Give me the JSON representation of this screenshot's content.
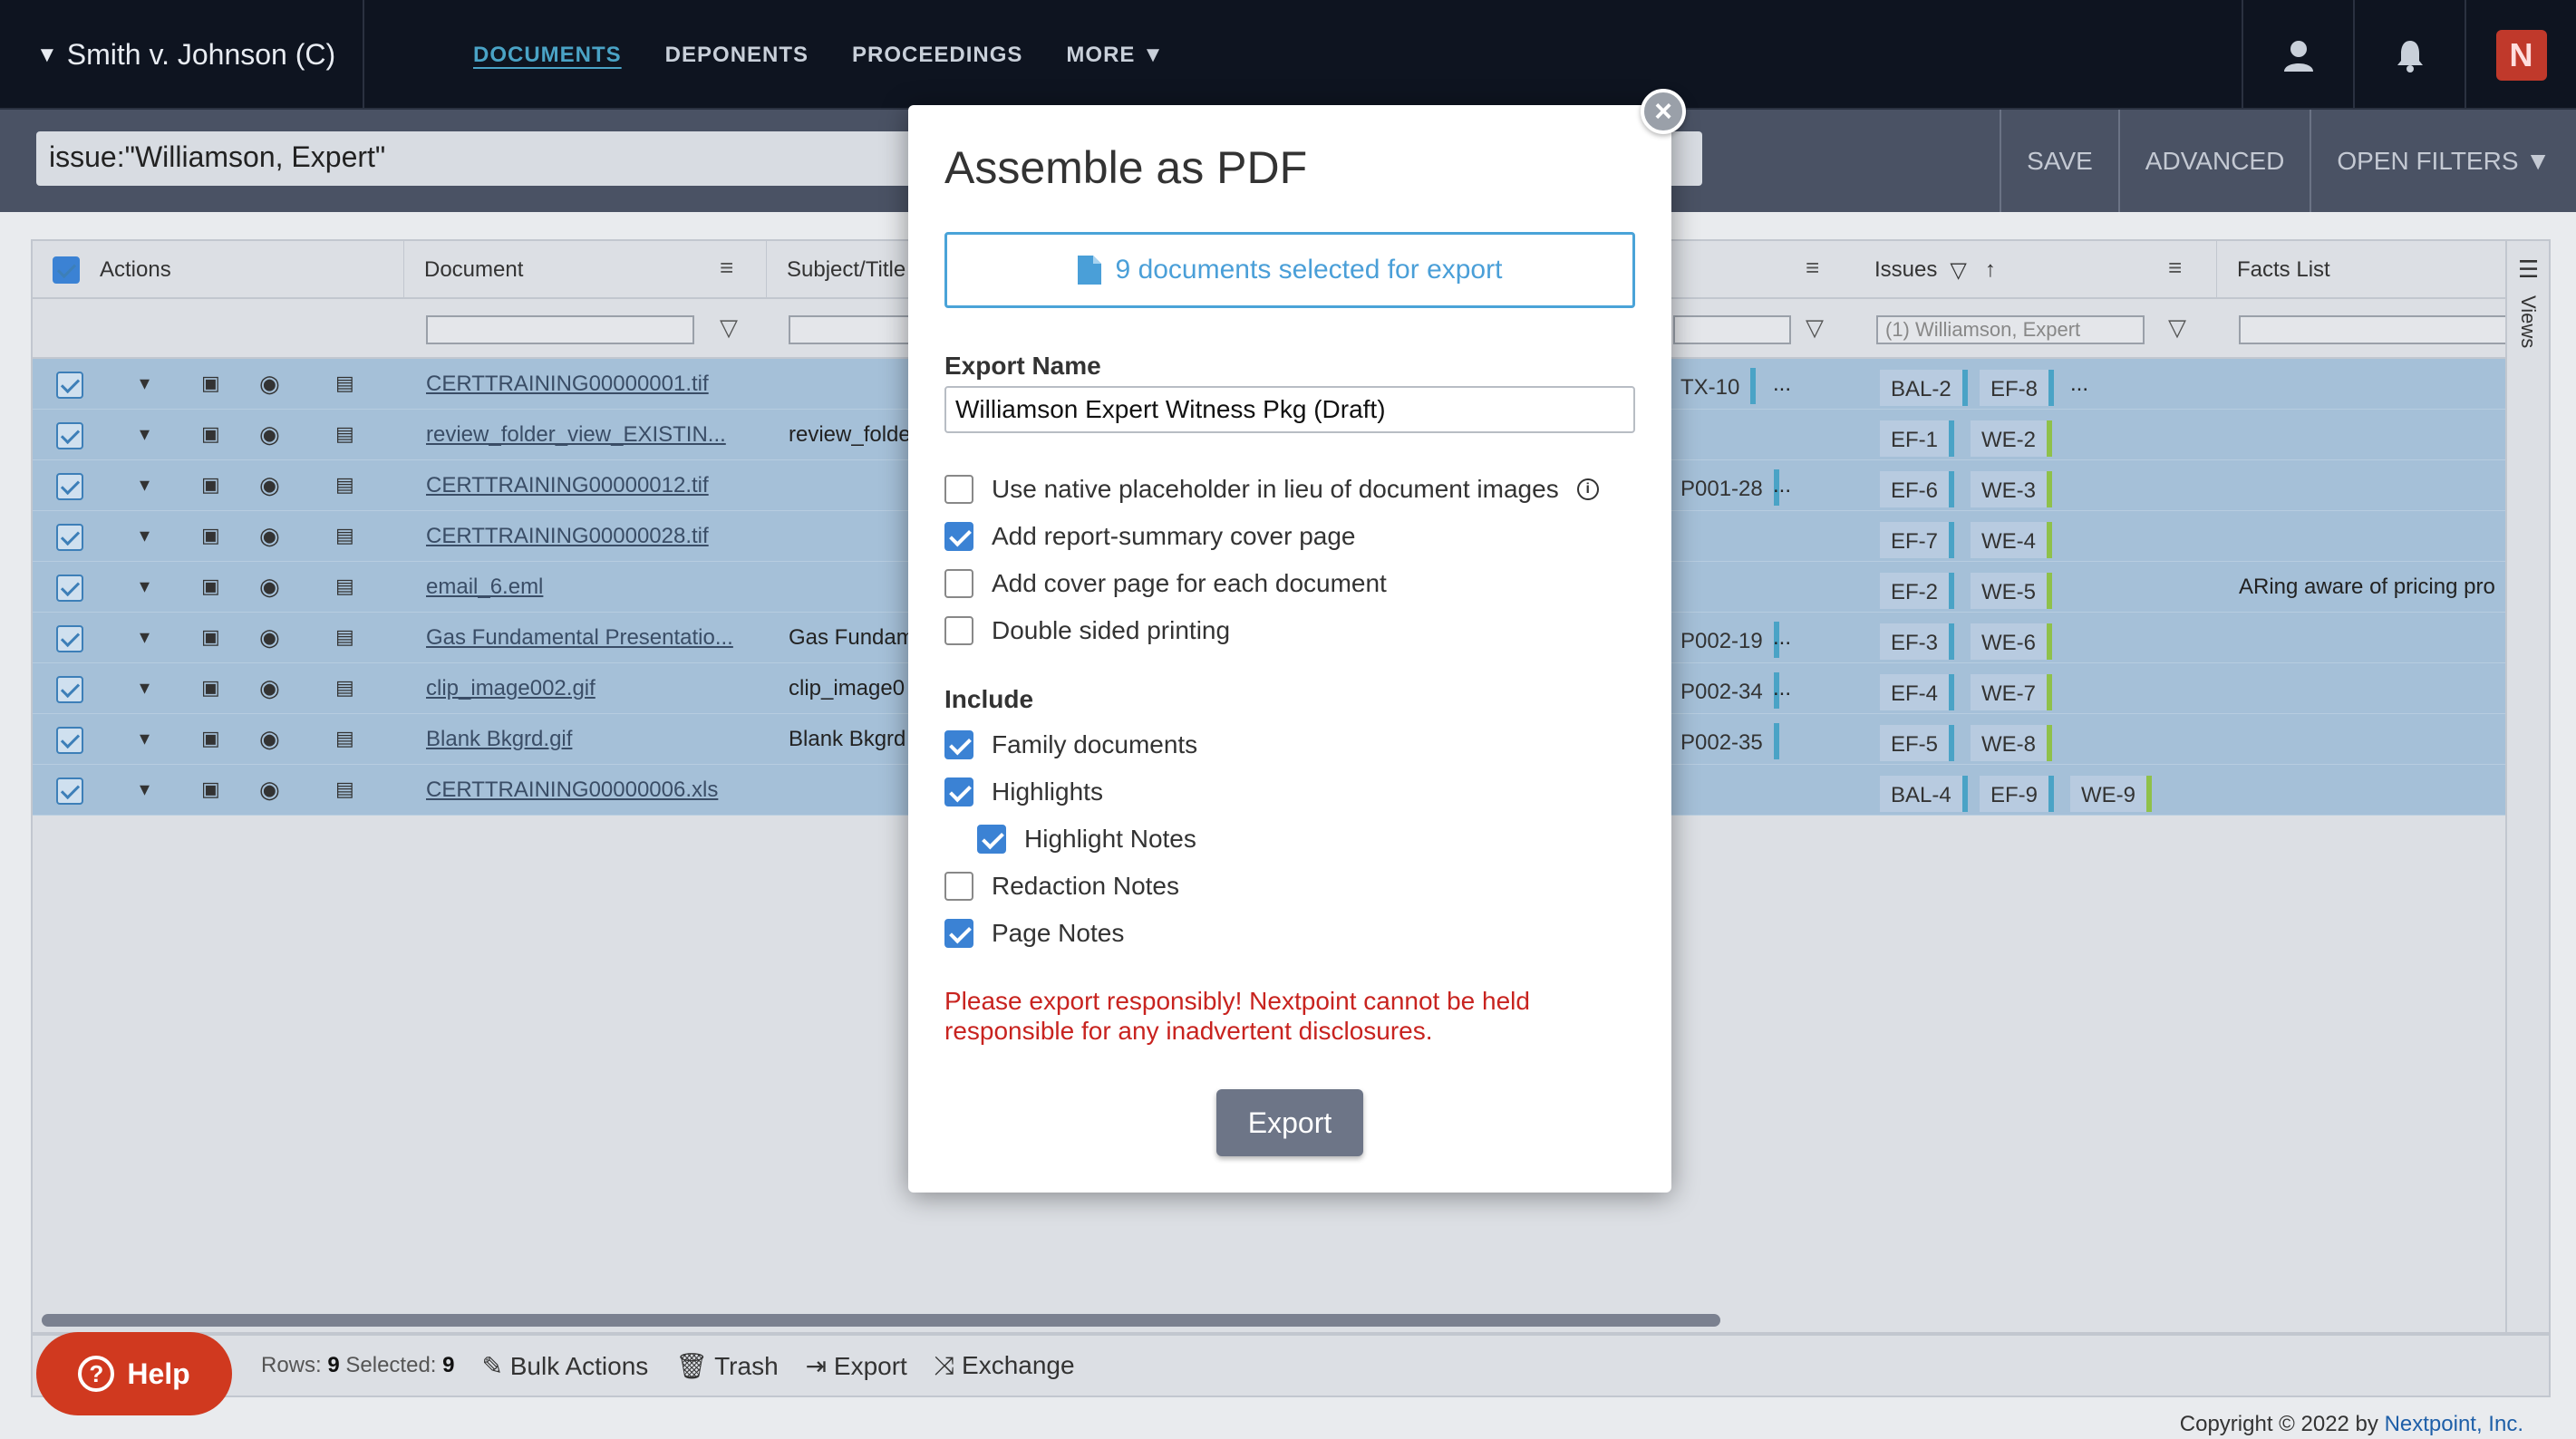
{
  "case_title": "Smith v. Johnson (C)",
  "nav": [
    "DOCUMENTS",
    "DEPONENTS",
    "PROCEEDINGS",
    "MORE ▼"
  ],
  "logo_text": "N",
  "search": {
    "query": "issue:\"Williamson, Expert\"",
    "buttons": [
      "SAVE",
      "ADVANCED",
      "OPEN FILTERS ▼"
    ]
  },
  "grid": {
    "headers": {
      "actions": "Actions",
      "document": "Document",
      "subject": "Subject/Title",
      "issues": "Issues",
      "facts": "Facts List"
    },
    "issues_filter": "(1) Williamson, Expert",
    "views_label": "Views",
    "rows": [
      {
        "doc": "CERTTRAINING00000001.tif",
        "subject": "",
        "ex": "TX-10",
        "ex_more": "...",
        "tags": [
          "BAL-2",
          "EF-8"
        ],
        "tags_more": "...",
        "facts": ""
      },
      {
        "doc": "review_folder_view_EXISTIN...",
        "subject": "review_folde",
        "ex": "",
        "ex_more": "",
        "tags": [
          "EF-1",
          "WE-2"
        ],
        "tags_more": "",
        "facts": ""
      },
      {
        "doc": "CERTTRAINING00000012.tif",
        "subject": "",
        "ex": "P001-28",
        "ex_more": "...",
        "tags": [
          "EF-6",
          "WE-3"
        ],
        "tags_more": "",
        "facts": ""
      },
      {
        "doc": "CERTTRAINING00000028.tif",
        "subject": "",
        "ex": "",
        "ex_more": "",
        "tags": [
          "EF-7",
          "WE-4"
        ],
        "tags_more": "",
        "facts": ""
      },
      {
        "doc": "email_6.eml",
        "subject": "",
        "ex": "",
        "ex_more": "",
        "tags": [
          "EF-2",
          "WE-5"
        ],
        "tags_more": "",
        "facts": "ARing aware of pricing pro"
      },
      {
        "doc": "Gas Fundamental Presentatio...",
        "subject": "Gas Fundam",
        "ex": "P002-19",
        "ex_more": "...",
        "tags": [
          "EF-3",
          "WE-6"
        ],
        "tags_more": "",
        "facts": ""
      },
      {
        "doc": "clip_image002.gif",
        "subject": "clip_image0",
        "ex": "P002-34",
        "ex_more": "...",
        "tags": [
          "EF-4",
          "WE-7"
        ],
        "tags_more": "",
        "facts": ""
      },
      {
        "doc": "Blank Bkgrd.gif",
        "subject": "Blank Bkgrd",
        "ex": "P002-35",
        "ex_more": "",
        "tags": [
          "EF-5",
          "WE-8"
        ],
        "tags_more": "",
        "facts": ""
      },
      {
        "doc": "CERTTRAINING00000006.xls",
        "subject": "",
        "ex": "",
        "ex_more": "",
        "tags": [
          "BAL-4",
          "EF-9",
          "WE-9"
        ],
        "tags_more": "",
        "facts": ""
      }
    ]
  },
  "footer": {
    "rows_label": "Rows:",
    "rows_value": "9",
    "selected_label": "Selected:",
    "selected_value": "9",
    "actions": [
      "Bulk Actions",
      "Trash",
      "Export",
      "Exchange"
    ],
    "help": "Help",
    "copyright_prefix": "Copyright © 2022 by ",
    "copyright_link": "Nextpoint, Inc."
  },
  "modal": {
    "title": "Assemble as PDF",
    "selected_text": "9 documents selected for export",
    "export_name_label": "Export Name",
    "export_name_value": "Williamson Expert Witness Pkg (Draft)",
    "options": [
      {
        "label": "Use native placeholder in lieu of document images",
        "checked": false
      },
      {
        "label": "Add report-summary cover page",
        "checked": true
      },
      {
        "label": "Add cover page for each document",
        "checked": false
      },
      {
        "label": "Double sided printing",
        "checked": false
      }
    ],
    "include_label": "Include",
    "include": [
      {
        "label": "Family documents",
        "checked": true
      },
      {
        "label": "Highlights",
        "checked": true
      },
      {
        "label": "Highlight Notes",
        "checked": true
      },
      {
        "label": "Redaction Notes",
        "checked": false
      },
      {
        "label": "Page Notes",
        "checked": true
      }
    ],
    "warning": "Please export responsibly! Nextpoint cannot be held responsible for any inadvertent disclosures.",
    "export_button": "Export",
    "close": "×"
  }
}
